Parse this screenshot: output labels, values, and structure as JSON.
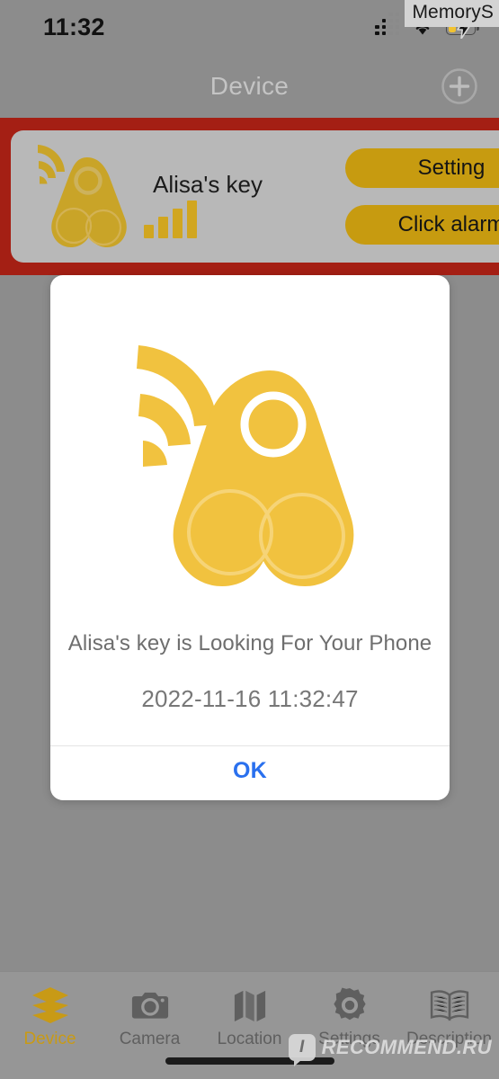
{
  "status_bar": {
    "time": "11:32",
    "signal_icon": "cellular-signal-dots-icon",
    "wifi_icon": "wifi-icon",
    "battery_icon": "battery-charging-icon"
  },
  "overlay_tag": {
    "label": "MemoryS"
  },
  "header": {
    "title": "Device",
    "add_icon": "plus-circle-icon"
  },
  "device_card": {
    "highlighted": true,
    "highlight_color": "#a41f14",
    "card_color": "#b8b8b8",
    "tracker_icon": "bluetooth-tracker-icon",
    "name": "Alisa's key",
    "signal_strength_icon": "signal-bars-icon",
    "signal_bars": 4,
    "buttons": [
      {
        "label": "Setting",
        "icon": "settings-button"
      },
      {
        "label": "Click alarm",
        "icon": "alarm-button"
      }
    ],
    "button_color": "#c79b10"
  },
  "modal": {
    "art_icon": "bluetooth-tracker-searching-icon",
    "message": "Alisa's key is Looking For Your Phone",
    "timestamp": "2022-11-16 11:32:47",
    "ok_label": "OK",
    "ok_color": "#2a70ee"
  },
  "tab_bar": {
    "active_color": "#c89a16",
    "inactive_color": "#5f5f5f",
    "items": [
      {
        "label": "Device",
        "icon": "layers-icon",
        "active": true
      },
      {
        "label": "Camera",
        "icon": "camera-icon",
        "active": false
      },
      {
        "label": "Location",
        "icon": "map-icon",
        "active": false
      },
      {
        "label": "Settings",
        "icon": "gear-icon",
        "active": false
      },
      {
        "label": "Description",
        "icon": "open-book-icon",
        "active": false
      }
    ]
  },
  "watermark": {
    "badge": "I",
    "text": "RECOMMEND.RU"
  }
}
